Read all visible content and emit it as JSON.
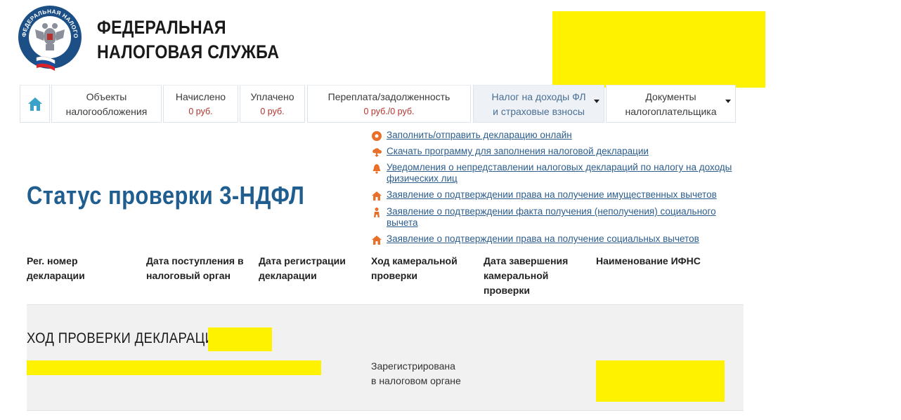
{
  "header": {
    "logo_text": "ФЕДЕРАЛЬНАЯ НАЛОГОВАЯ СЛУЖБА",
    "brand_line1": "ФЕДЕРАЛЬНАЯ",
    "brand_line2": "НАЛОГОВАЯ СЛУЖБА"
  },
  "nav": {
    "tabs": [
      {
        "line1": "Объекты",
        "line2": "налогообложения"
      },
      {
        "line1": "Начислено",
        "sub": "0 руб."
      },
      {
        "line1": "Уплачено",
        "sub": "0 руб."
      },
      {
        "line1": "Переплата/задолженность",
        "sub": "0 руб./0 руб."
      },
      {
        "line1": "Налог на доходы ФЛ",
        "line2": "и страховые взносы"
      },
      {
        "line1": "Документы",
        "line2": "налогоплательщика"
      }
    ]
  },
  "links": [
    {
      "icon": "disc-icon",
      "text": "Заполнить/отправить декларацию онлайн"
    },
    {
      "icon": "download-cloud-icon",
      "text": "Скачать программу для заполнения налоговой декларации"
    },
    {
      "icon": "bell-icon",
      "text": "Уведомления о непредставлении налоговых деклараций по налогу на доходы физических лиц"
    },
    {
      "icon": "house-icon",
      "text": "Заявление о подтверждении права на получение имущественных вычетов"
    },
    {
      "icon": "person-icon",
      "text": "Заявление о подтверждении факта получения (неполучения) социального вычета"
    },
    {
      "icon": "house-icon",
      "text": "Заявление о подтверждении права на получение социальных вычетов"
    }
  ],
  "page": {
    "title": "Статус проверки 3-НДФЛ"
  },
  "table": {
    "headers": [
      "Рег. номер декларации",
      "Дата поступления в налоговый орган",
      "Дата регистрации декларации",
      "Ход камеральной проверки",
      "Дата завершения камеральной проверки",
      "Наименование ИФНС"
    ],
    "row_title": "ХОД ПРОВЕРКИ ДЕКЛАРАЦИИ ЗА",
    "status_line1": "Зарегистрирована",
    "status_line2": "в налоговом органе"
  },
  "colors": {
    "accent": "#1f5e8f",
    "link": "#2c5d8c",
    "amount": "#b5322c",
    "redaction": "#fff200",
    "icon_orange": "#e8702a"
  }
}
